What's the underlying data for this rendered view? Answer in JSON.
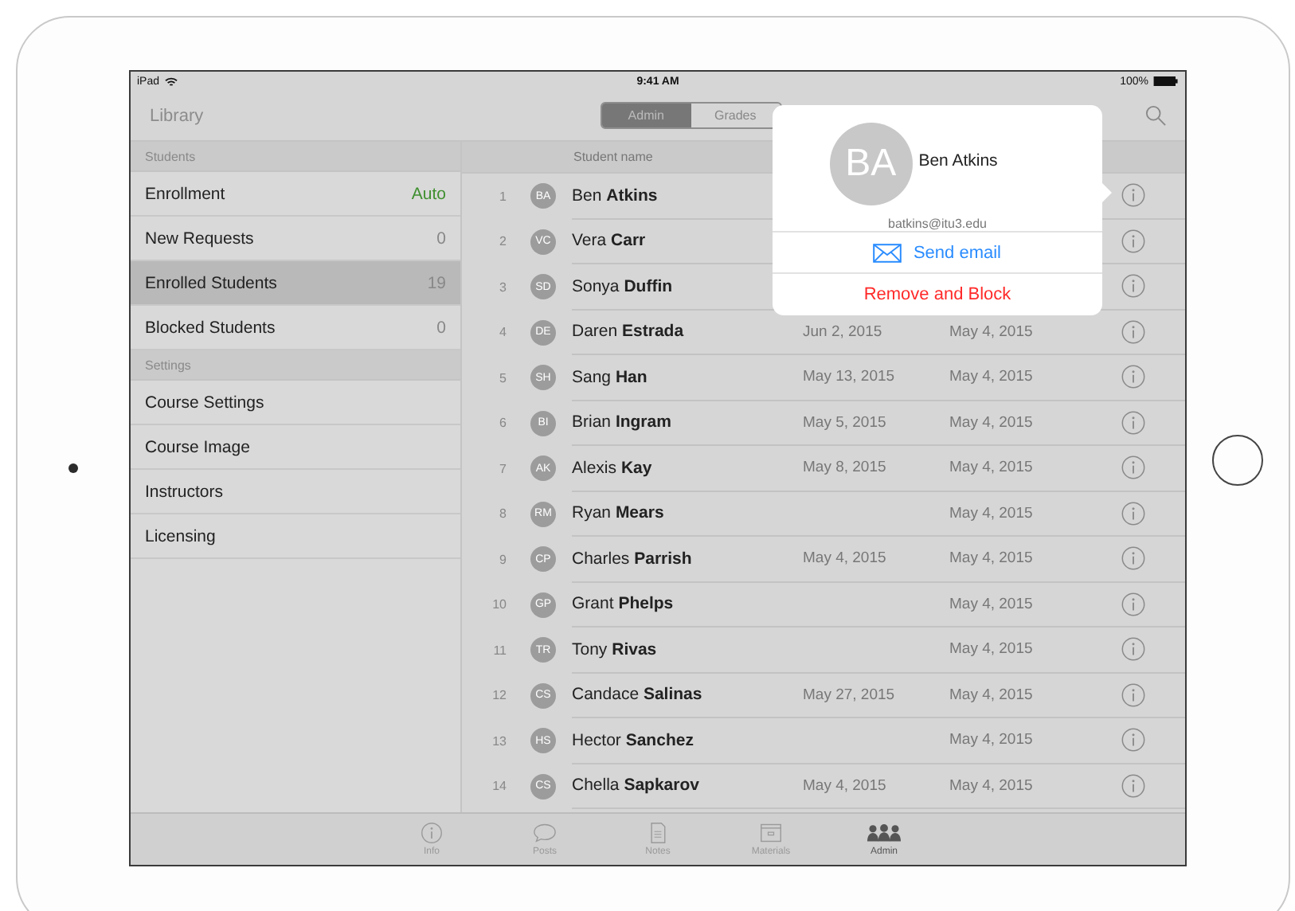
{
  "status_bar": {
    "carrier": "iPad",
    "time": "9:41 AM",
    "battery": "100%"
  },
  "nav_bar": {
    "back": "Library",
    "segments": [
      {
        "label": "Admin",
        "selected": true
      },
      {
        "label": "Grades",
        "selected": false
      }
    ]
  },
  "sidebar": {
    "sections": [
      {
        "title": "Students",
        "items": [
          {
            "label": "Enrollment",
            "value": "Auto",
            "kind": "status",
            "selected": false
          },
          {
            "label": "New Requests",
            "value": "0",
            "kind": "count",
            "selected": false
          },
          {
            "label": "Enrolled Students",
            "value": "19",
            "kind": "count",
            "selected": true
          },
          {
            "label": "Blocked Students",
            "value": "0",
            "kind": "count",
            "selected": false
          }
        ]
      },
      {
        "title": "Settings",
        "items": [
          {
            "label": "Course Settings",
            "selected": false
          },
          {
            "label": "Course Image",
            "selected": false
          },
          {
            "label": "Instructors",
            "selected": false
          },
          {
            "label": "Licensing",
            "selected": false
          }
        ]
      }
    ]
  },
  "table": {
    "columns": [
      "Student name"
    ],
    "rows": [
      {
        "number": "1",
        "initials": "BA",
        "name": "Ben **Atkins**"
      },
      {
        "number": "2",
        "initials": "VC",
        "name": "Vera **Carr**"
      },
      {
        "number": "3",
        "initials": "SD",
        "name": "Sonya **Duffin**"
      },
      {
        "number": "4",
        "initials": "DE",
        "name": "Daren **Estrada**",
        "date_1": "Jun 2, 2015",
        "date_2": "May 4, 2015"
      },
      {
        "number": "5",
        "initials": "SH",
        "name": "Sang **Han**",
        "date_1": "May 13, 2015",
        "date_2": "May 4, 2015"
      },
      {
        "number": "6",
        "initials": "BI",
        "name": "Brian **Ingram**",
        "date_1": "May 5, 2015",
        "date_2": "May 4, 2015"
      },
      {
        "number": "7",
        "initials": "AK",
        "name": "Alexis **Kay**",
        "date_1": "May 8, 2015",
        "date_2": "May 4, 2015"
      },
      {
        "number": "8",
        "initials": "RM",
        "name": "Ryan **Mears**",
        "date_2": "May 4, 2015"
      },
      {
        "number": "9",
        "initials": "CP",
        "name": "Charles **Parrish**",
        "date_1": "May 4, 2015",
        "date_2": "May 4, 2015"
      },
      {
        "number": "10",
        "initials": "GP",
        "name": "Grant **Phelps**",
        "date_2": "May 4, 2015"
      },
      {
        "number": "11",
        "initials": "TR",
        "name": "Tony **Rivas**",
        "date_2": "May 4, 2015"
      },
      {
        "number": "12",
        "initials": "CS",
        "name": "Candace **Salinas**",
        "date_1": "May 27, 2015",
        "date_2": "May 4, 2015"
      },
      {
        "number": "13",
        "initials": "HS",
        "name": "Hector **Sanchez**",
        "date_2": "May 4, 2015"
      },
      {
        "number": "14",
        "initials": "CS",
        "name": "Chella **Sapkarov**",
        "date_1": "May 4, 2015",
        "date_2": "May 4, 2015"
      }
    ]
  },
  "popover": {
    "initials": "BA",
    "name": "Ben Atkins",
    "email": "batkins@itu3.edu",
    "actions": [
      {
        "label": "Send email",
        "kind": "mail"
      },
      {
        "label": "Remove and Block",
        "kind": "destructive"
      }
    ]
  },
  "tab_bar": {
    "tabs": [
      {
        "label": "Info",
        "selected": false
      },
      {
        "label": "Posts",
        "selected": false
      },
      {
        "label": "Notes",
        "selected": false
      },
      {
        "label": "Materials",
        "selected": false
      },
      {
        "label": "Admin",
        "selected": true
      }
    ]
  }
}
